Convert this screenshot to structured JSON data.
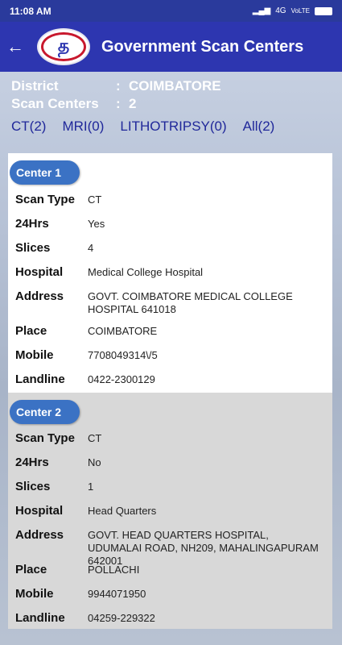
{
  "status": {
    "time": "11:08 AM",
    "network": "4G",
    "volte": "VoLTE"
  },
  "header": {
    "title": "Government Scan Centers",
    "logo_text": "த"
  },
  "info": {
    "district_label": "District",
    "district_value": "COIMBATORE",
    "count_label": "Scan Centers",
    "count_value": "2",
    "sep": ":"
  },
  "tabs": [
    "CT(2)",
    "MRI(0)",
    "LITHOTRIPSY(0)",
    "All(2)"
  ],
  "labels": {
    "scan_type": "Scan Type",
    "hrs": "24Hrs",
    "slices": "Slices",
    "hospital": "Hospital",
    "address": "Address",
    "place": "Place",
    "mobile": "Mobile",
    "landline": "Landline"
  },
  "centers": [
    {
      "name": "Center 1",
      "scan_type": "CT",
      "hrs": "Yes",
      "slices": "4",
      "hospital": "Medical College Hospital",
      "address": "GOVT. COIMBATORE MEDICAL COLLEGE HOSPITAL   641018",
      "place": "COIMBATORE",
      "mobile": "7708049314\\/5",
      "landline": "0422-2300129"
    },
    {
      "name": "Center 2",
      "scan_type": "CT",
      "hrs": "No",
      "slices": "1",
      "hospital": "Head Quarters",
      "address": "GOVT. HEAD QUARTERS HOSPITAL, UDUMALAI ROAD, NH209, MAHALINGAPURAM   642001",
      "place": "POLLACHI",
      "mobile": "9944071950",
      "landline": "04259-229322"
    }
  ]
}
